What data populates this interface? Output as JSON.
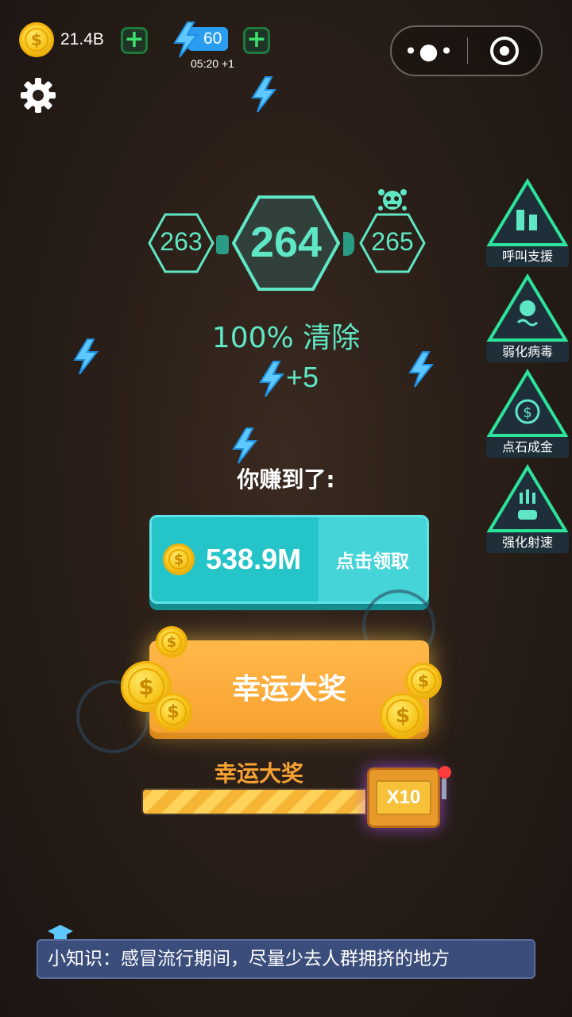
{
  "top_bar": {
    "coins": "21.4B",
    "energy": "60",
    "energy_timer": "05:20 +1"
  },
  "icons": {
    "coin": "coin-icon",
    "lightning": "lightning-icon",
    "settings": "gear-icon",
    "menu": "more-dots-icon",
    "record": "record-icon",
    "boss": "virus-boss-icon"
  },
  "level": {
    "previous": "263",
    "current": "264",
    "next": "265"
  },
  "result": {
    "clear_text": "100% 清除",
    "energy_reward": "+5",
    "earned_title": "你赚到了:"
  },
  "claim": {
    "amount": "538.9M",
    "button_label": "点击领取"
  },
  "lucky": {
    "button_label": "幸运大奖",
    "progress_label": "幸运大奖",
    "progress": 0.98,
    "multiplier": "X10"
  },
  "skills": [
    {
      "label": "呼叫支援",
      "icon": "call-support-icon"
    },
    {
      "label": "弱化病毒",
      "icon": "weaken-virus-icon"
    },
    {
      "label": "点石成金",
      "icon": "midas-touch-icon"
    },
    {
      "label": "强化射速",
      "icon": "fire-rate-icon"
    }
  ],
  "tip": "小知识：感冒流行期间，尽量少去人群拥挤的地方",
  "colors": {
    "accent_teal": "#5fe7c5",
    "claim_teal": "#25c4c8",
    "lucky_orange": "#f7a230",
    "lightning_blue": "#2a9df0"
  }
}
